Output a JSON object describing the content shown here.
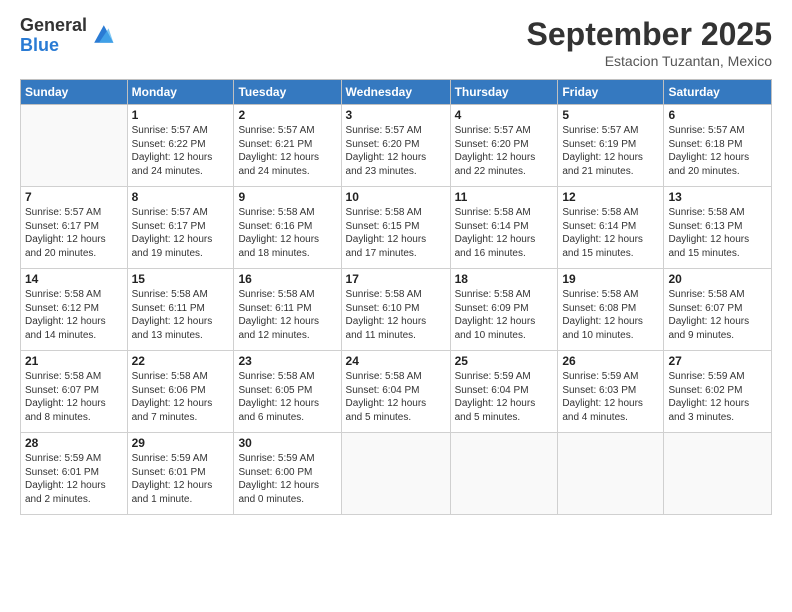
{
  "logo": {
    "general": "General",
    "blue": "Blue"
  },
  "title": "September 2025",
  "subtitle": "Estacion Tuzantan, Mexico",
  "weekdays": [
    "Sunday",
    "Monday",
    "Tuesday",
    "Wednesday",
    "Thursday",
    "Friday",
    "Saturday"
  ],
  "weeks": [
    [
      {
        "day": null,
        "info": null
      },
      {
        "day": "1",
        "info": "Sunrise: 5:57 AM\nSunset: 6:22 PM\nDaylight: 12 hours\nand 24 minutes."
      },
      {
        "day": "2",
        "info": "Sunrise: 5:57 AM\nSunset: 6:21 PM\nDaylight: 12 hours\nand 24 minutes."
      },
      {
        "day": "3",
        "info": "Sunrise: 5:57 AM\nSunset: 6:20 PM\nDaylight: 12 hours\nand 23 minutes."
      },
      {
        "day": "4",
        "info": "Sunrise: 5:57 AM\nSunset: 6:20 PM\nDaylight: 12 hours\nand 22 minutes."
      },
      {
        "day": "5",
        "info": "Sunrise: 5:57 AM\nSunset: 6:19 PM\nDaylight: 12 hours\nand 21 minutes."
      },
      {
        "day": "6",
        "info": "Sunrise: 5:57 AM\nSunset: 6:18 PM\nDaylight: 12 hours\nand 20 minutes."
      }
    ],
    [
      {
        "day": "7",
        "info": "Sunrise: 5:57 AM\nSunset: 6:17 PM\nDaylight: 12 hours\nand 20 minutes."
      },
      {
        "day": "8",
        "info": "Sunrise: 5:57 AM\nSunset: 6:17 PM\nDaylight: 12 hours\nand 19 minutes."
      },
      {
        "day": "9",
        "info": "Sunrise: 5:58 AM\nSunset: 6:16 PM\nDaylight: 12 hours\nand 18 minutes."
      },
      {
        "day": "10",
        "info": "Sunrise: 5:58 AM\nSunset: 6:15 PM\nDaylight: 12 hours\nand 17 minutes."
      },
      {
        "day": "11",
        "info": "Sunrise: 5:58 AM\nSunset: 6:14 PM\nDaylight: 12 hours\nand 16 minutes."
      },
      {
        "day": "12",
        "info": "Sunrise: 5:58 AM\nSunset: 6:14 PM\nDaylight: 12 hours\nand 15 minutes."
      },
      {
        "day": "13",
        "info": "Sunrise: 5:58 AM\nSunset: 6:13 PM\nDaylight: 12 hours\nand 15 minutes."
      }
    ],
    [
      {
        "day": "14",
        "info": "Sunrise: 5:58 AM\nSunset: 6:12 PM\nDaylight: 12 hours\nand 14 minutes."
      },
      {
        "day": "15",
        "info": "Sunrise: 5:58 AM\nSunset: 6:11 PM\nDaylight: 12 hours\nand 13 minutes."
      },
      {
        "day": "16",
        "info": "Sunrise: 5:58 AM\nSunset: 6:11 PM\nDaylight: 12 hours\nand 12 minutes."
      },
      {
        "day": "17",
        "info": "Sunrise: 5:58 AM\nSunset: 6:10 PM\nDaylight: 12 hours\nand 11 minutes."
      },
      {
        "day": "18",
        "info": "Sunrise: 5:58 AM\nSunset: 6:09 PM\nDaylight: 12 hours\nand 10 minutes."
      },
      {
        "day": "19",
        "info": "Sunrise: 5:58 AM\nSunset: 6:08 PM\nDaylight: 12 hours\nand 10 minutes."
      },
      {
        "day": "20",
        "info": "Sunrise: 5:58 AM\nSunset: 6:07 PM\nDaylight: 12 hours\nand 9 minutes."
      }
    ],
    [
      {
        "day": "21",
        "info": "Sunrise: 5:58 AM\nSunset: 6:07 PM\nDaylight: 12 hours\nand 8 minutes."
      },
      {
        "day": "22",
        "info": "Sunrise: 5:58 AM\nSunset: 6:06 PM\nDaylight: 12 hours\nand 7 minutes."
      },
      {
        "day": "23",
        "info": "Sunrise: 5:58 AM\nSunset: 6:05 PM\nDaylight: 12 hours\nand 6 minutes."
      },
      {
        "day": "24",
        "info": "Sunrise: 5:58 AM\nSunset: 6:04 PM\nDaylight: 12 hours\nand 5 minutes."
      },
      {
        "day": "25",
        "info": "Sunrise: 5:59 AM\nSunset: 6:04 PM\nDaylight: 12 hours\nand 5 minutes."
      },
      {
        "day": "26",
        "info": "Sunrise: 5:59 AM\nSunset: 6:03 PM\nDaylight: 12 hours\nand 4 minutes."
      },
      {
        "day": "27",
        "info": "Sunrise: 5:59 AM\nSunset: 6:02 PM\nDaylight: 12 hours\nand 3 minutes."
      }
    ],
    [
      {
        "day": "28",
        "info": "Sunrise: 5:59 AM\nSunset: 6:01 PM\nDaylight: 12 hours\nand 2 minutes."
      },
      {
        "day": "29",
        "info": "Sunrise: 5:59 AM\nSunset: 6:01 PM\nDaylight: 12 hours\nand 1 minute."
      },
      {
        "day": "30",
        "info": "Sunrise: 5:59 AM\nSunset: 6:00 PM\nDaylight: 12 hours\nand 0 minutes."
      },
      {
        "day": null,
        "info": null
      },
      {
        "day": null,
        "info": null
      },
      {
        "day": null,
        "info": null
      },
      {
        "day": null,
        "info": null
      }
    ]
  ]
}
